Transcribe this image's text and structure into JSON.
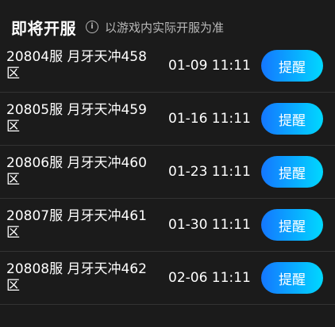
{
  "header": {
    "title": "即将开服",
    "info_icon": "info-icon",
    "note": "以游戏内实际开服为准"
  },
  "servers": [
    {
      "name": "20804服 月牙天冲458区",
      "time": "01-09 11:11",
      "button": "提醒"
    },
    {
      "name": "20805服 月牙天冲459区",
      "time": "01-16 11:11",
      "button": "提醒"
    },
    {
      "name": "20806服 月牙天冲460区",
      "time": "01-23 11:11",
      "button": "提醒"
    },
    {
      "name": "20807服 月牙天冲461区",
      "time": "01-30 11:11",
      "button": "提醒"
    },
    {
      "name": "20808服 月牙天冲462区",
      "time": "02-06 11:11",
      "button": "提醒"
    }
  ],
  "colors": {
    "background": "#1b1b1b",
    "button_gradient_start": "#1477ff",
    "button_gradient_end": "#00d8ff",
    "divider": "#333333"
  }
}
